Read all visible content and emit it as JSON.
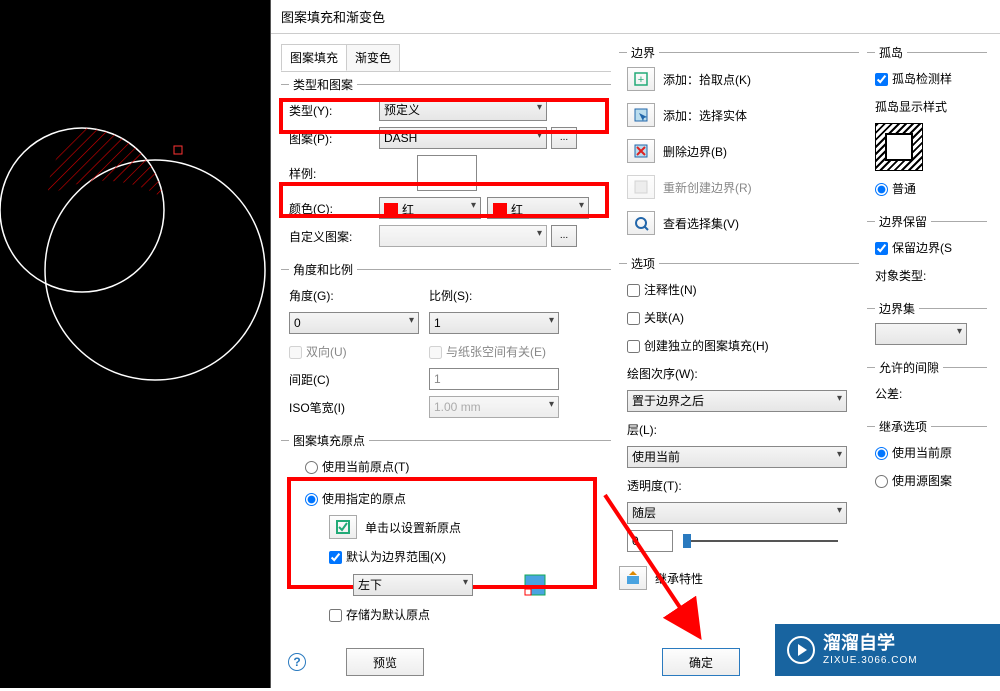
{
  "dialog_title": "图案填充和渐变色",
  "tabs": {
    "hatch": "图案填充",
    "gradient": "渐变色"
  },
  "type_pattern": {
    "group": "类型和图案",
    "type_label": "类型(Y):",
    "type_value": "预定义",
    "pattern_label": "图案(P):",
    "pattern_value": "DASH",
    "sample_label": "样例:",
    "color_label": "颜色(C):",
    "color1": "红",
    "color2": "红",
    "custom_label": "自定义图案:"
  },
  "angle_scale": {
    "group": "角度和比例",
    "angle_label": "角度(G):",
    "angle_value": "0",
    "scale_label": "比例(S):",
    "scale_value": "1",
    "bidir": "双向(U)",
    "paper_rel": "与纸张空间有关(E)",
    "spacing_label": "间距(C)",
    "spacing_value": "1",
    "isopen_label": "ISO笔宽(I)",
    "isopen_value": "1.00 mm"
  },
  "origin": {
    "group": "图案填充原点",
    "use_current": "使用当前原点(T)",
    "use_specified": "使用指定的原点",
    "click_new": "单击以设置新原点",
    "default_bounds": "默认为边界范围(X)",
    "pos": "左下",
    "store_default": "存储为默认原点"
  },
  "boundary": {
    "group": "边界",
    "add_pick": "添加：拾取点(K)",
    "add_select": "添加：选择实体",
    "del_bound": "删除边界(B)",
    "recreate": "重新创建边界(R)",
    "view_sel": "查看选择集(V)"
  },
  "options": {
    "group": "选项",
    "annotative": "注释性(N)",
    "associative": "关联(A)",
    "independent": "创建独立的图案填充(H)",
    "draw_order_label": "绘图次序(W):",
    "draw_order": "置于边界之后",
    "layer_label": "层(L):",
    "layer": "使用当前",
    "transparency_label": "透明度(T):",
    "transparency": "随层",
    "slider_val": "0"
  },
  "inherit": "继承特性",
  "islands": {
    "group": "孤岛",
    "detect": "孤岛检测样",
    "style": "孤岛显示样式",
    "normal": "普通"
  },
  "retain": {
    "group": "边界保留",
    "retain_cb": "保留边界(S",
    "obj_type": "对象类型:"
  },
  "bset": {
    "group": "边界集"
  },
  "gap": {
    "group": "允许的间隙",
    "tol": "公差:"
  },
  "inherit_opt": {
    "group": "继承选项",
    "use_current": "使用当前原",
    "use_source": "使用源图案"
  },
  "footer": {
    "preview": "预览",
    "ok": "确定"
  },
  "watermark": {
    "name": "溜溜自学",
    "url": "ZIXUE.3066.COM"
  }
}
